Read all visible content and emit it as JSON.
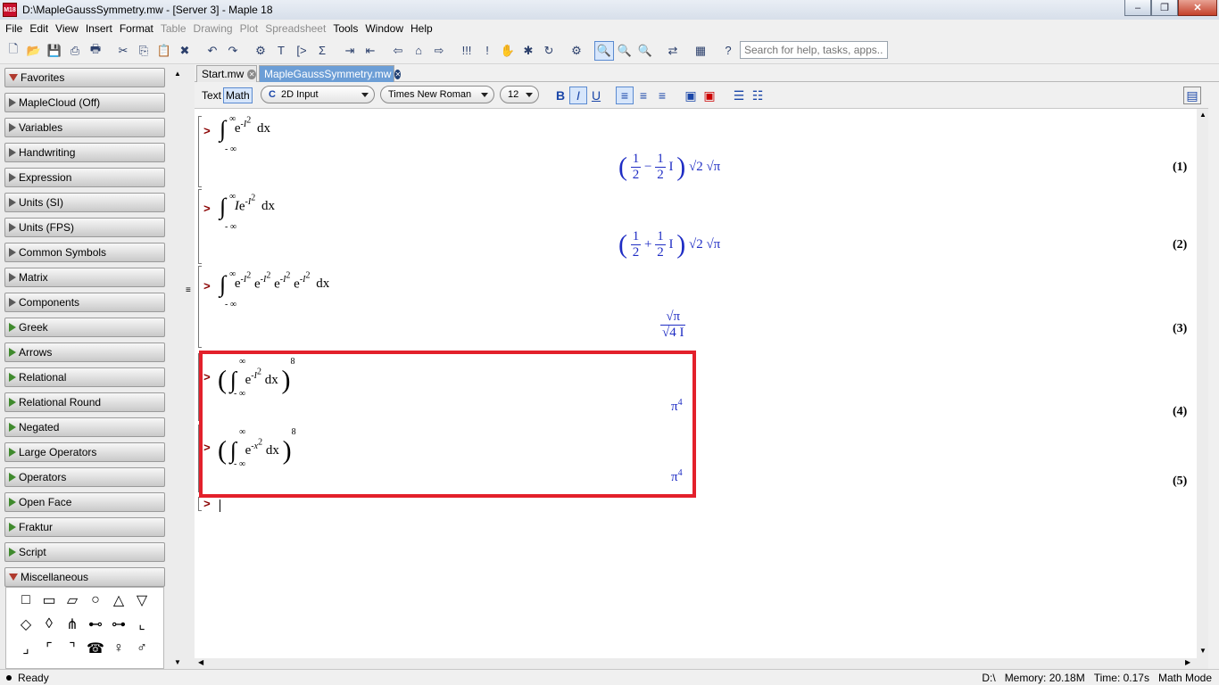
{
  "window": {
    "title": "D:\\MapleGaussSymmetry.mw - [Server 3] - Maple 18",
    "app_badge": "M18"
  },
  "menu": [
    "File",
    "Edit",
    "View",
    "Insert",
    "Format",
    "Table",
    "Drawing",
    "Plot",
    "Spreadsheet",
    "Tools",
    "Window",
    "Help"
  ],
  "menu_disabled": [
    "Table",
    "Drawing",
    "Plot",
    "Spreadsheet"
  ],
  "search": {
    "placeholder": "Search for help, tasks, apps..."
  },
  "palettes": [
    {
      "label": "Favorites",
      "expanded": true
    },
    {
      "label": "MapleCloud (Off)"
    },
    {
      "label": "Variables"
    },
    {
      "label": "Handwriting"
    },
    {
      "label": "Expression"
    },
    {
      "label": "Units (SI)"
    },
    {
      "label": "Units (FPS)"
    },
    {
      "label": "Common Symbols"
    },
    {
      "label": "Matrix"
    },
    {
      "label": "Components"
    },
    {
      "label": "Greek"
    },
    {
      "label": "Arrows"
    },
    {
      "label": "Relational"
    },
    {
      "label": "Relational Round"
    },
    {
      "label": "Negated"
    },
    {
      "label": "Large Operators"
    },
    {
      "label": "Operators"
    },
    {
      "label": "Open Face"
    },
    {
      "label": "Fraktur"
    },
    {
      "label": "Script"
    },
    {
      "label": "Miscellaneous",
      "expanded": true
    }
  ],
  "misc_symbols": [
    "□",
    "▭",
    "▱",
    "○",
    "△",
    "▽",
    "◇",
    "◊",
    "⋔",
    "⊷",
    "⊶",
    "⌞",
    "⌟",
    "⌜",
    "⌝",
    "☎",
    "♀",
    "♂"
  ],
  "tabs": [
    {
      "label": "Start.mw",
      "active": false
    },
    {
      "label": "MapleGaussSymmetry.mw",
      "active": true
    }
  ],
  "context_bar": {
    "text_label": "Text",
    "math_label": "Math",
    "input_mode": "2D Input",
    "input_mode_prefix": "C",
    "font": "Times New Roman",
    "size": "12",
    "bold": "B",
    "italic": "I",
    "underline": "U"
  },
  "prompt_symbol": ">",
  "math": {
    "int_symbol": "∫",
    "infinity": "∞",
    "neg_infinity": "- ∞",
    "e": "e",
    "exp1": "-I",
    "exp_sq": "2",
    "dx": "dx",
    "I": "I",
    "eight": "8",
    "x": "x",
    "half": "1",
    "two": "2",
    "minus": "−",
    "plus": "+",
    "sqrt2": "√2",
    "sqrtpi": "√π",
    "pi": "π",
    "four": "4",
    "sqrt4I": "√4 I"
  },
  "equation_labels": [
    "(1)",
    "(2)",
    "(3)",
    "(4)",
    "(5)"
  ],
  "status": {
    "left": "Ready",
    "path": "D:\\",
    "memory": "Memory: 20.18M",
    "time": "Time: 0.17s",
    "mode": "Math Mode"
  },
  "colors": {
    "highlight": "#e3202b",
    "output_blue": "#1f2dc4",
    "prompt_red": "#8a0000"
  }
}
